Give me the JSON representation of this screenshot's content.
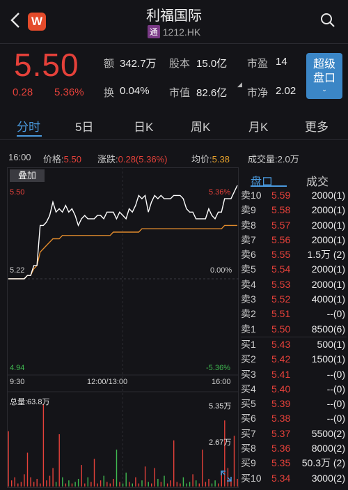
{
  "header": {
    "stock_name": "利福国际",
    "badge": "通",
    "code": "1212.HK",
    "logo_letter": "W"
  },
  "quote": {
    "price": "5.50",
    "change": "0.28",
    "change_pct": "5.36%",
    "amount_label": "额",
    "amount_value": "342.7万",
    "shares_label": "股本",
    "shares_value": "15.0亿",
    "pe_label": "市盈",
    "pe_value": "14",
    "turnover_label": "换",
    "turnover_value": "0.04%",
    "mktcap_label": "市值",
    "mktcap_value": "82.6亿",
    "pb_label": "市净",
    "pb_value": "2.02",
    "super_button": [
      "超级",
      "盘口"
    ]
  },
  "tabs": [
    "分时",
    "5日",
    "日K",
    "周K",
    "月K",
    "更多"
  ],
  "info_line": {
    "time": "16:00",
    "price_label": "价格:",
    "price_value": "5.50",
    "change_label": "涨跌:",
    "change_value": "0.28(5.36%)",
    "avg_label": "均价:",
    "avg_value": "5.38",
    "volume_label": "成交量:",
    "volume_value": "2.0万"
  },
  "chart": {
    "overlay_label": "叠加",
    "y_high": "5.50",
    "y_high_pct": "5.36%",
    "y_mid": "5.22",
    "y_mid_pct": "0.00%",
    "y_low": "4.94",
    "y_low_pct": "-5.36%",
    "x_labels": [
      "9:30",
      "12:00/13:00",
      "16:00"
    ],
    "volume_total": "总量:63.8万",
    "volume_max": "5.35万",
    "volume_half": "2.67万"
  },
  "chart_data": {
    "type": "line",
    "ylim": [
      4.94,
      5.5
    ],
    "price_series": [
      5.22,
      5.22,
      5.22,
      5.22,
      5.22,
      5.22,
      5.23,
      5.23,
      5.26,
      5.26,
      5.38,
      5.38,
      5.39,
      5.41,
      5.45,
      5.42,
      5.43,
      5.42,
      5.44,
      5.42,
      5.43,
      5.41,
      5.38,
      5.4,
      5.41,
      5.4,
      5.4,
      5.4,
      5.41,
      5.41,
      5.4,
      5.42,
      5.42,
      5.42,
      5.4,
      5.42,
      5.41,
      5.4,
      5.43,
      5.42,
      5.44,
      5.47,
      5.46,
      5.47,
      5.42,
      5.45,
      5.47,
      5.46,
      5.47,
      5.46,
      5.46,
      5.46,
      5.47,
      5.47,
      5.47,
      5.46,
      5.43,
      5.42,
      5.42,
      5.4,
      5.4,
      5.4,
      5.4,
      5.43,
      5.41,
      5.4,
      5.42,
      5.42,
      5.46,
      5.46,
      5.46,
      5.48,
      5.5
    ],
    "avg_series": [
      5.22,
      5.22,
      5.22,
      5.22,
      5.22,
      5.22,
      5.23,
      5.23,
      5.25,
      5.26,
      5.3,
      5.31,
      5.32,
      5.33,
      5.34,
      5.34,
      5.34,
      5.35,
      5.35,
      5.35,
      5.35,
      5.35,
      5.35,
      5.35,
      5.35,
      5.35,
      5.35,
      5.35,
      5.35,
      5.35,
      5.35,
      5.35,
      5.35,
      5.36,
      5.36,
      5.36,
      5.36,
      5.36,
      5.36,
      5.36,
      5.36,
      5.36,
      5.37,
      5.37,
      5.37,
      5.37,
      5.37,
      5.37,
      5.37,
      5.37,
      5.37,
      5.37,
      5.37,
      5.37,
      5.37,
      5.37,
      5.37,
      5.37,
      5.37,
      5.37,
      5.37,
      5.37,
      5.37,
      5.37,
      5.37,
      5.37,
      5.37,
      5.37,
      5.38,
      5.38,
      5.38,
      5.38,
      5.38
    ],
    "volumes": [
      3.6,
      0.4,
      0.6,
      0.2,
      0.3,
      0.8,
      2.2,
      0.6,
      0.3,
      0.5,
      0.2,
      5.35,
      0.4,
      0.7,
      1.2,
      0.3,
      3.4,
      0.6,
      0.2,
      0.4,
      0.2,
      0.3,
      0.5,
      1.4,
      0.2,
      0.6,
      0.3,
      1.8,
      0.2,
      0.4,
      0.7,
      0.3,
      0.2,
      0.5,
      2.4,
      0.3,
      0.2,
      0.9,
      0.3,
      0.2,
      0.6,
      0.2,
      0.4,
      1.3,
      0.3,
      0.2,
      1.2,
      0.5,
      0.3,
      0.7,
      0.2,
      0.4,
      3.0,
      0.3,
      0.2,
      0.6,
      0.2,
      0.3,
      0.8,
      0.4,
      0.2,
      2.4,
      0.3,
      0.5,
      0.2,
      0.4,
      0.2,
      0.9,
      4.3,
      1.2,
      0.4,
      3.3,
      0.5
    ]
  },
  "orderbook": {
    "tab_active": "盘口",
    "tab_inactive": "成交",
    "rows": [
      {
        "label": "卖10",
        "price": "5.59",
        "vol": "2000(1)"
      },
      {
        "label": "卖9",
        "price": "5.58",
        "vol": "2000(1)"
      },
      {
        "label": "卖8",
        "price": "5.57",
        "vol": "2000(1)"
      },
      {
        "label": "卖7",
        "price": "5.56",
        "vol": "2000(1)"
      },
      {
        "label": "卖6",
        "price": "5.55",
        "vol": "1.5万 (2)"
      },
      {
        "label": "卖5",
        "price": "5.54",
        "vol": "2000(1)"
      },
      {
        "label": "卖4",
        "price": "5.53",
        "vol": "2000(1)"
      },
      {
        "label": "卖3",
        "price": "5.52",
        "vol": "4000(1)"
      },
      {
        "label": "卖2",
        "price": "5.51",
        "vol": "--(0)"
      },
      {
        "label": "卖1",
        "price": "5.50",
        "vol": "8500(6)"
      },
      {
        "label": "买1",
        "price": "5.43",
        "vol": "500(1)"
      },
      {
        "label": "买2",
        "price": "5.42",
        "vol": "1500(1)"
      },
      {
        "label": "买3",
        "price": "5.41",
        "vol": "--(0)"
      },
      {
        "label": "买4",
        "price": "5.40",
        "vol": "--(0)"
      },
      {
        "label": "买5",
        "price": "5.39",
        "vol": "--(0)"
      },
      {
        "label": "买6",
        "price": "5.38",
        "vol": "--(0)"
      },
      {
        "label": "买7",
        "price": "5.37",
        "vol": "5500(2)"
      },
      {
        "label": "买8",
        "price": "5.36",
        "vol": "8000(2)"
      },
      {
        "label": "买9",
        "price": "5.35",
        "vol": "50.3万 (2)"
      },
      {
        "label": "买10",
        "price": "5.34",
        "vol": "3000(2)"
      }
    ]
  },
  "colors": {
    "up": "#e5413a",
    "down": "#3fb950",
    "accent": "#4a9ade",
    "avg_line": "#e08a2c",
    "price_line": "#ffffff"
  }
}
